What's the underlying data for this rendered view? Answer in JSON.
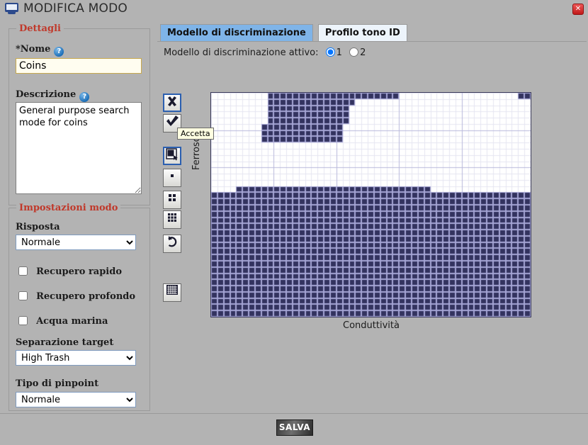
{
  "window": {
    "title": "MODIFICA MODO",
    "icon": "monitor-icon",
    "close_label": "✕"
  },
  "details_panel": {
    "legend": "Dettagli",
    "name_label": "*Nome",
    "name_help": "?",
    "name_value": "Coins",
    "name_placeholder": "",
    "description_label": "Descrizione",
    "description_help": "?",
    "description_value": "General purpose search mode for coins",
    "description_placeholder": ""
  },
  "mode_settings_panel": {
    "legend": "Impostazioni modo",
    "response_label": "Risposta",
    "response_value": "Normale",
    "response_options": [
      "Normale"
    ],
    "fast_recovery_label": "Recupero rapido",
    "fast_recovery_checked": false,
    "deep_recovery_label": "Recupero profondo",
    "deep_recovery_checked": false,
    "sea_water_label": "Acqua marina",
    "sea_water_checked": false,
    "target_separation_label": "Separazione target",
    "target_separation_value": "High Trash",
    "target_separation_options": [
      "High Trash"
    ],
    "pinpoint_type_label": "Tipo di pinpoint",
    "pinpoint_type_value": "Normale",
    "pinpoint_type_options": [
      "Normale"
    ]
  },
  "tabs": [
    {
      "label": "Modello di discriminazione",
      "active": true
    },
    {
      "label": "Profilo tono ID",
      "active": false
    }
  ],
  "active_model": {
    "label": "Modello di discriminazione attivo:",
    "option1": "1",
    "option2": "2",
    "selected": "1"
  },
  "toolbar": [
    {
      "name": "reject-button",
      "icon": "x-mark-icon",
      "selected": true,
      "tooltip": ""
    },
    {
      "name": "accept-button",
      "icon": "check-mark-icon",
      "selected": false,
      "tooltip": "Accetta"
    },
    {
      "name": "lasso-tool",
      "icon": "region-select-icon",
      "selected": true,
      "tooltip": ""
    },
    {
      "name": "brush-1x1-tool",
      "icon": "single-cell-icon",
      "selected": false,
      "tooltip": ""
    },
    {
      "name": "brush-2x2-tool",
      "icon": "four-cell-icon",
      "selected": false,
      "tooltip": ""
    },
    {
      "name": "brush-3x3-tool",
      "icon": "nine-cell-icon",
      "selected": false,
      "tooltip": ""
    },
    {
      "name": "undo-button",
      "icon": "undo-arrow-icon",
      "selected": false,
      "tooltip": ""
    },
    {
      "name": "fill-grid-button",
      "icon": "grid-fill-icon",
      "selected": false,
      "tooltip": ""
    }
  ],
  "tooltip_text": "Accetta",
  "footer": {
    "save_label": "SALVA"
  },
  "chart_data": {
    "type": "heatmap",
    "title": "",
    "xlabel": "Conduttività",
    "ylabel": "Ferroso",
    "cols": 51,
    "rows": 36,
    "cell_fill_color": "#33335f",
    "cell_grid_color": "#a6a6d6",
    "background_color": "#ffffff",
    "minor_grid_color": "#e6e6f2",
    "major_grid_color": "#b9b9dc",
    "major_grid_cols": [
      10,
      20,
      30,
      40
    ],
    "major_grid_rows": [
      6,
      12,
      18,
      24,
      30
    ],
    "xlim": [
      0,
      51
    ],
    "ylim": [
      0,
      36
    ],
    "grid": true,
    "legend": "none",
    "accepted_regions": [
      {
        "name": "upper-blob",
        "col_start": 9,
        "col_end": 29,
        "row_start": 0,
        "row_end": 0
      },
      {
        "name": "upper-blob-body-a",
        "col_start": 9,
        "col_end": 22,
        "row_start": 1,
        "row_end": 1
      },
      {
        "name": "upper-blob-body-b",
        "col_start": 9,
        "col_end": 21,
        "row_start": 2,
        "row_end": 4
      },
      {
        "name": "upper-blob-body-c",
        "col_start": 8,
        "col_end": 20,
        "row_start": 5,
        "row_end": 7
      },
      {
        "name": "top-right-pair",
        "col_start": 49,
        "col_end": 50,
        "row_start": 0,
        "row_end": 0
      },
      {
        "name": "lower-mass-step",
        "col_start": 4,
        "col_end": 34,
        "row_start": 15,
        "row_end": 15
      },
      {
        "name": "lower-mass-full",
        "col_start": 0,
        "col_end": 50,
        "row_start": 16,
        "row_end": 35
      }
    ]
  }
}
